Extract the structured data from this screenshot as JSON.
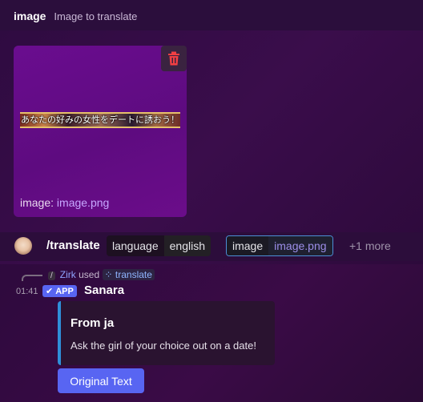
{
  "option_header": {
    "name": "image",
    "description": "Image to translate"
  },
  "attachment": {
    "preview_text": "あなたの好みの女性をデートに誘おう！",
    "label_prefix": "image: ",
    "filename": "image.png",
    "delete_icon": "trash-icon"
  },
  "command_bar": {
    "command": "/translate",
    "params": [
      {
        "name": "language",
        "value": "english",
        "active": false
      },
      {
        "name": "image",
        "value": "image.png",
        "active": true
      }
    ],
    "more": "+1 more"
  },
  "message": {
    "reply": {
      "slash": "/",
      "user": "Zirk",
      "used": "used",
      "command": "translate"
    },
    "time": "01:41",
    "badge": "APP",
    "author": "Sanara",
    "embed": {
      "title": "From ja",
      "description": "Ask the girl of your choice out on a date!",
      "accent": "#2f8fd9"
    },
    "button_label": "Original Text"
  },
  "colors": {
    "blurple": "#5865f2",
    "link": "#c7a7ff"
  }
}
